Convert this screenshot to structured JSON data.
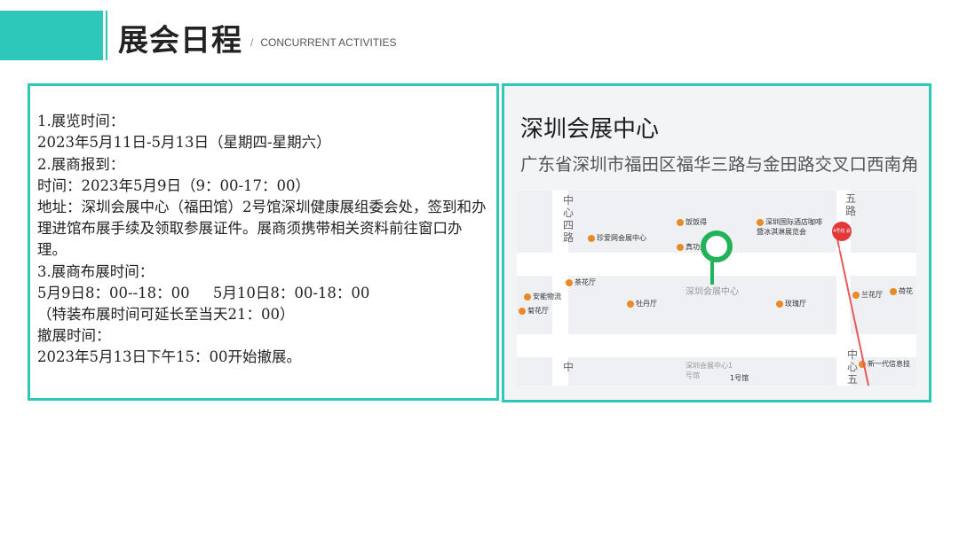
{
  "header": {
    "title": "展会日程",
    "subtitle_slash": "/",
    "subtitle": "CONCURRENT ACTIVITIES",
    "accent_color": "#2ec8bb"
  },
  "info": {
    "lines": [
      "1.展览时间：",
      "2023年5月11日-5月13日（星期四-星期六）",
      "2.展商报到：",
      "时间：2023年5月9日（9：00-17：00）",
      "地址：深圳会展中心（福田馆）2号馆深圳健康展组委会处，签到和办理进馆布展手续及领取参展证件。展商须携带相关资料前往窗口办理。",
      "3.展商布展时间：",
      "5月9日8：00--18：00     5月10日8：00-18：00",
      "（特装布展时间可延长至当天21：00）",
      "撤展时间：",
      "2023年5月13日下午15：00开始撤展。"
    ]
  },
  "map": {
    "place_name": "深圳会展中心",
    "address": "广东省深圳市福田区福华三路与金田路交叉口西南角",
    "center_label": "深圳会展中心",
    "metro_badge": "4号线 会展中心",
    "pin_color": "#22b35a",
    "pois": [
      {
        "label": "饭饭得"
      },
      {
        "label": "真功夫"
      },
      {
        "label": "珍爱网会展中心"
      },
      {
        "label": "深圳国际酒店咖啡 暨冰淇淋展览会"
      },
      {
        "label": "茶花厅"
      },
      {
        "label": "安能物流"
      },
      {
        "label": "菊花厅"
      },
      {
        "label": "牡丹厅"
      },
      {
        "label": "玫瑰厅"
      },
      {
        "label": "兰花厅"
      },
      {
        "label": "荷花"
      },
      {
        "label": "新一代信息技"
      },
      {
        "label": "深圳会展中心1号馆"
      },
      {
        "label": "1号馆"
      }
    ],
    "road_labels": [
      "中心四路",
      "五路",
      "中心五",
      "中"
    ]
  }
}
